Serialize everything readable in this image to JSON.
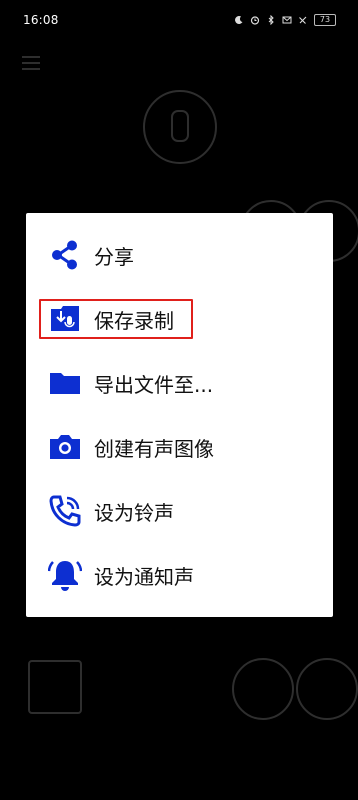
{
  "status_bar": {
    "time": "16:08",
    "battery": "73"
  },
  "dialog": {
    "items": [
      {
        "label": "分享",
        "icon": "share-icon"
      },
      {
        "label": "保存录制",
        "icon": "save-recording-icon"
      },
      {
        "label": "导出文件至...",
        "icon": "folder-icon"
      },
      {
        "label": "创建有声图像",
        "icon": "camera-icon"
      },
      {
        "label": "设为铃声",
        "icon": "phone-ring-icon"
      },
      {
        "label": "设为通知声",
        "icon": "bell-icon"
      }
    ],
    "highlighted_index": 1
  },
  "colors": {
    "icon_blue": "#0d2fd1",
    "highlight_red": "#e0201b",
    "dialog_bg": "#ffffff",
    "backdrop": "#000000"
  }
}
